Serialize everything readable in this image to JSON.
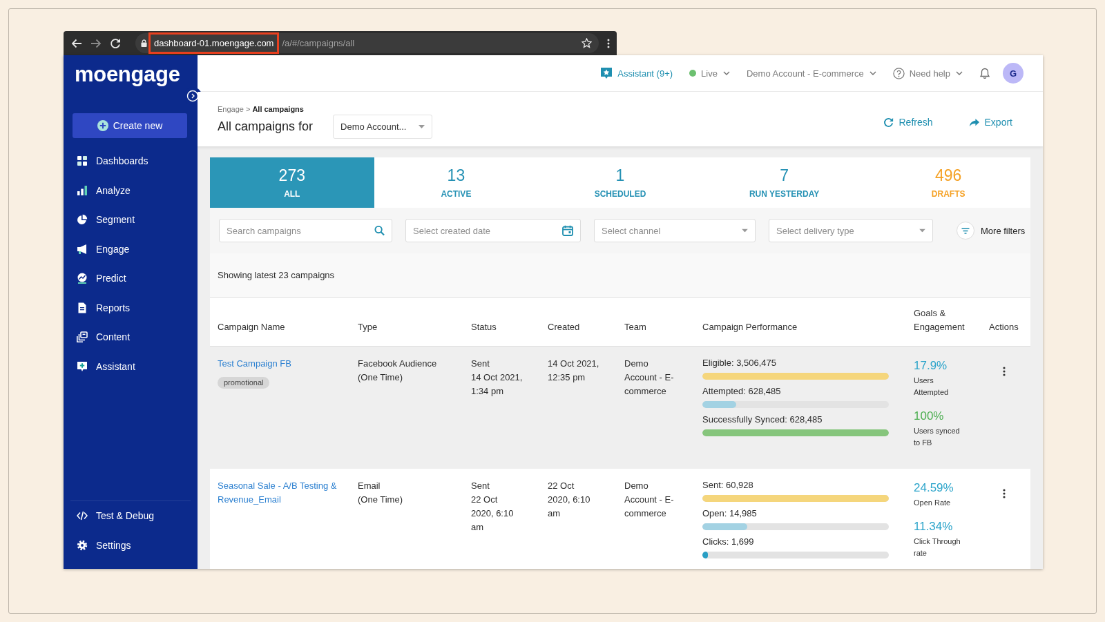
{
  "browser": {
    "url_host": "dashboard-01.moengage.com",
    "url_path": "/a/#/campaigns/all",
    "host_highlighted": true
  },
  "sidebar": {
    "logo": "moengage",
    "create_button": "Create new",
    "items": [
      {
        "label": "Dashboards"
      },
      {
        "label": "Analyze"
      },
      {
        "label": "Segment"
      },
      {
        "label": "Engage"
      },
      {
        "label": "Predict"
      },
      {
        "label": "Reports"
      },
      {
        "label": "Content"
      },
      {
        "label": "Assistant"
      }
    ],
    "footer_items": [
      {
        "label": "Test & Debug"
      },
      {
        "label": "Settings"
      }
    ]
  },
  "topbar": {
    "assistant": "Assistant (9+)",
    "environment": "Live",
    "account": "Demo Account - E-commerce",
    "help": "Need help",
    "avatar": "G"
  },
  "header": {
    "breadcrumb": {
      "parent": "Engage",
      "separator": ">",
      "current": "All campaigns"
    },
    "title": "All campaigns for",
    "account_select": "Demo Account...",
    "actions": [
      {
        "label": "Refresh"
      },
      {
        "label": "Export"
      }
    ]
  },
  "stats": [
    {
      "count": "273",
      "label": "ALL",
      "selected": true,
      "color": "#2b96b7"
    },
    {
      "count": "13",
      "label": "ACTIVE",
      "selected": false,
      "color": "#2591b4"
    },
    {
      "count": "1",
      "label": "SCHEDULED",
      "selected": false,
      "color": "#2591b4"
    },
    {
      "count": "7",
      "label": "RUN YESTERDAY",
      "selected": false,
      "color": "#2591b4"
    },
    {
      "count": "496",
      "label": "DRAFTS",
      "selected": false,
      "color": "#f5a124"
    }
  ],
  "filters": [
    {
      "kind": "search",
      "placeholder": "Search campaigns"
    },
    {
      "kind": "date",
      "placeholder": "Select created date"
    },
    {
      "kind": "select",
      "placeholder": "Select channel"
    },
    {
      "kind": "select",
      "placeholder": "Select delivery type"
    }
  ],
  "more_filters": "More filters",
  "summary": "Showing latest 23 campaigns",
  "table": {
    "columns": [
      "Campaign Name",
      "Type",
      "Status",
      "Created",
      "Team",
      "Campaign Performance",
      "Goals & Engagement",
      "Actions"
    ],
    "rows": [
      {
        "highlighted": true,
        "name": "Test Campaign FB",
        "tag": "promotional",
        "type": [
          "Facebook Audience",
          "(One Time)"
        ],
        "status": [
          "Sent",
          "14 Oct 2021,",
          "1:34 pm"
        ],
        "created": [
          "14 Oct 2021,",
          "12:35 pm"
        ],
        "team": "Demo Account - E-commerce",
        "performance": [
          {
            "label": "Eligible: 3,506,475",
            "level": 1,
            "color": "#f5d67c"
          },
          {
            "label": "Attempted: 628,485",
            "level": 0.18,
            "color": "#a3d2e3"
          },
          {
            "label": "Successfully Synced: 628,485",
            "level": 1,
            "color": "#86c57c"
          }
        ],
        "goals": [
          {
            "value": "17.9%",
            "label": "Users Attempted",
            "color": "#2ba4ca"
          },
          {
            "value": "100%",
            "label": "Users synced to FB",
            "color": "#4cae50"
          }
        ]
      },
      {
        "highlighted": false,
        "name": "Seasonal Sale - A/B Testing & Revenue_Email",
        "type": [
          "Email",
          "(One Time)"
        ],
        "status": [
          "Sent",
          "22 Oct",
          "2020, 6:10",
          "am"
        ],
        "created": [
          "22 Oct",
          "2020, 6:10",
          "am"
        ],
        "team": "Demo Account - E-commerce",
        "performance": [
          {
            "label": "Sent: 60,928",
            "level": 1,
            "color": "#f5d67c"
          },
          {
            "label": "Open: 14,985",
            "level": 0.24,
            "color": "#a3d2e3"
          },
          {
            "label": "Clicks: 1,699",
            "level": 0.03,
            "color": "#2a9fc4"
          }
        ],
        "goals": [
          {
            "value": "24.59%",
            "label": "Open Rate",
            "color": "#2ba4ca"
          },
          {
            "value": "11.34%",
            "label": "Click Through rate",
            "color": "#2ba4ca"
          }
        ]
      }
    ]
  }
}
